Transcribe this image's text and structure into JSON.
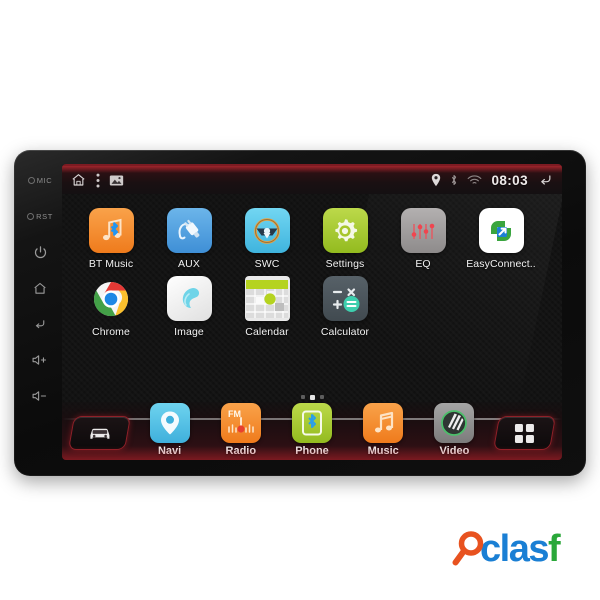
{
  "device": {
    "type": "android-car-stereo-head-unit",
    "bezel_buttons": [
      {
        "name": "mic",
        "label": "MIC",
        "icon": "mic-dot-icon"
      },
      {
        "name": "reset",
        "label": "RST",
        "icon": "reset-dot-icon"
      },
      {
        "name": "power",
        "label": "",
        "icon": "power-icon"
      },
      {
        "name": "home",
        "label": "",
        "icon": "home-icon"
      },
      {
        "name": "back",
        "label": "",
        "icon": "back-arrow-icon"
      },
      {
        "name": "volume-up",
        "label": "",
        "icon": "volume-up-icon"
      },
      {
        "name": "volume-down",
        "label": "",
        "icon": "volume-down-icon"
      }
    ]
  },
  "statusbar": {
    "left_icons": [
      {
        "name": "home-icon",
        "label": "Home"
      },
      {
        "name": "overflow-menu-icon",
        "label": "Menu"
      },
      {
        "name": "screenshot-icon",
        "label": "Screenshot"
      }
    ],
    "right_icons": [
      {
        "name": "location-pin-icon",
        "label": "GPS"
      },
      {
        "name": "bluetooth-icon",
        "label": "Bluetooth"
      },
      {
        "name": "wifi-icon",
        "label": "Wi-Fi"
      }
    ],
    "time": "08:03",
    "back_icon": "back-arrow-icon"
  },
  "home": {
    "rows": [
      [
        {
          "label": "BT Music",
          "icon": "bt-music-icon",
          "bg": "#f2872c"
        },
        {
          "label": "AUX",
          "icon": "aux-plug-icon",
          "bg": "#4a9fe0"
        },
        {
          "label": "SWC",
          "icon": "steering-wheel-icon",
          "bg": "#4fc3e8"
        },
        {
          "label": "Settings",
          "icon": "gear-icon",
          "bg": "#a8c830"
        },
        {
          "label": "EQ",
          "icon": "equalizer-icon",
          "bg": "#9b9b9b"
        },
        {
          "label": "EasyConnect..",
          "icon": "easyconnect-icon",
          "bg": "#ffffff"
        }
      ],
      [
        {
          "label": "Chrome",
          "icon": "chrome-icon",
          "bg": "#ffffff"
        },
        {
          "label": "Image",
          "icon": "image-gallery-icon",
          "bg": "#f0f0f0"
        },
        {
          "label": "Calendar",
          "icon": "calendar-icon",
          "bg": "#e8e8e8"
        },
        {
          "label": "Calculator",
          "icon": "calculator-icon",
          "bg": "#4a5358"
        }
      ]
    ],
    "page_dots": {
      "count": 3,
      "active_index": 1
    }
  },
  "dock": {
    "left_button": {
      "name": "car-info-button",
      "icon": "car-icon"
    },
    "right_button": {
      "name": "all-apps-button",
      "icon": "app-grid-icon"
    },
    "items": [
      {
        "label": "Navi",
        "icon": "navigation-pin-icon",
        "bg": "#4fc3e8"
      },
      {
        "label": "Radio",
        "icon": "fm-radio-icon",
        "bg": "#f2872c"
      },
      {
        "label": "Phone",
        "icon": "bluetooth-phone-icon",
        "bg": "#a8c830"
      },
      {
        "label": "Music",
        "icon": "music-note-icon",
        "bg": "#f2872c"
      },
      {
        "label": "Video",
        "icon": "video-disc-icon",
        "bg": "#8f8f8f"
      }
    ]
  },
  "watermark": {
    "text_primary": "clas",
    "text_accent": "f",
    "icon": "magnifier-icon",
    "color_primary": "#1a7fd4",
    "color_accent": "#2aa83a",
    "color_magnifier": "#e8521f"
  }
}
